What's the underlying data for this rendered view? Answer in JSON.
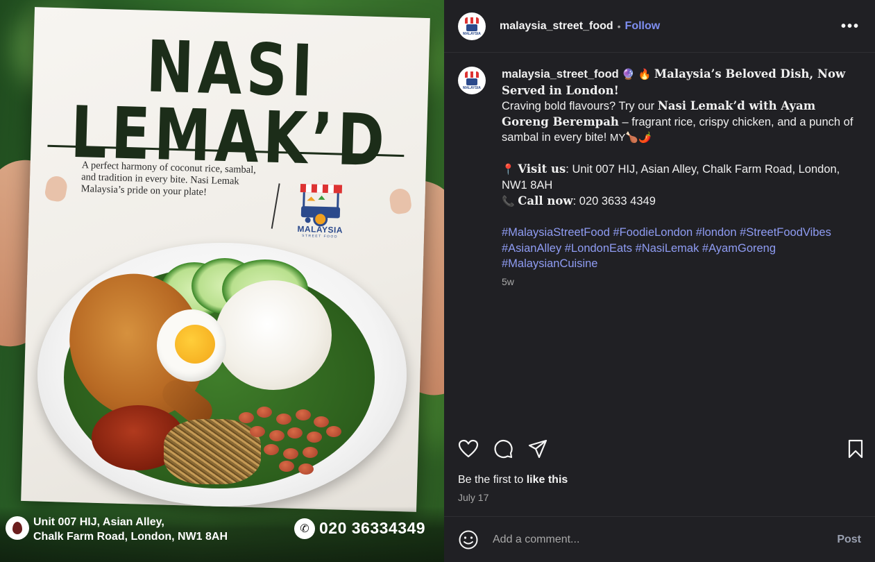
{
  "flyer": {
    "title_line1": "NASI",
    "title_line2": "LEMAK’D",
    "tagline": "A perfect harmony of coconut rice, sambal, and tradition in every bite. Nasi Lemak Malaysia’s pride on your plate!",
    "logo_text": "MALAYSIA",
    "logo_sub": "STREET FOOD",
    "address_line1": "Unit 007 HIJ, Asian Alley,",
    "address_line2": "Chalk Farm Road, London, NW1 8AH",
    "phone": "020 36334349"
  },
  "header": {
    "username": "malaysia_street_food",
    "separator": "•",
    "follow_label": "Follow",
    "more_label": "•••"
  },
  "caption": {
    "username": "malaysia_street_food",
    "emoji1": "🔮",
    "emoji2": "🔥",
    "headline": "Malaysia’s Beloved Dish, Now Served in London!",
    "p1_a": "Craving bold flavours? Try our ",
    "p1_b": "Nasi Lemak’d with Ayam Goreng Berempah",
    "p1_c": " – fragrant rice, crispy chicken, and a punch of sambal in every bite! ",
    "p1_emoji": "MY🍗🌶️",
    "visit_emoji": "📍",
    "visit_label": "Visit us",
    "visit_text": ": Unit 007 HIJ, Asian Alley, Chalk Farm Road, London, NW1 8AH",
    "call_emoji": "📞",
    "call_label": "Call now",
    "call_text": ": 020 3633 4349",
    "hashtags": "#MalaysiaStreetFood #FoodieLondon #london #StreetFoodVibes #AsianAlley #LondonEats #NasiLemak #AyamGoreng #MalaysianCuisine",
    "time_ago": "5w"
  },
  "actions": {
    "like_icon": "heart-icon",
    "comment_icon": "comment-icon",
    "share_icon": "paper-plane-icon",
    "save_icon": "bookmark-icon"
  },
  "likes": {
    "prefix": "Be the first to ",
    "action": "like this"
  },
  "date": "July 17",
  "comment": {
    "placeholder": "Add a comment...",
    "post_label": "Post"
  }
}
